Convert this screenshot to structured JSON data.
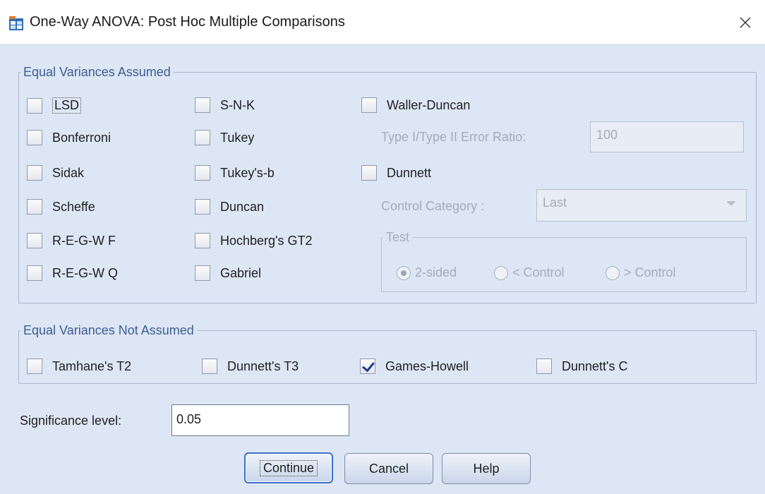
{
  "window": {
    "title": "One-Way ANOVA: Post Hoc Multiple Comparisons",
    "close_glyph": "×"
  },
  "equal_assumed": {
    "legend": "Equal Variances Assumed",
    "col1": [
      {
        "label": "LSD",
        "checked": false
      },
      {
        "label": "Bonferroni",
        "checked": false
      },
      {
        "label": "Sidak",
        "checked": false
      },
      {
        "label": "Scheffe",
        "checked": false
      },
      {
        "label": "R-E-G-W F",
        "checked": false
      },
      {
        "label": "R-E-G-W Q",
        "checked": false
      }
    ],
    "col2": [
      {
        "label": "S-N-K",
        "checked": false
      },
      {
        "label": "Tukey",
        "checked": false
      },
      {
        "label": "Tukey's-b",
        "checked": false
      },
      {
        "label": "Duncan",
        "checked": false
      },
      {
        "label": "Hochberg's GT2",
        "checked": false
      },
      {
        "label": "Gabriel",
        "checked": false
      }
    ],
    "waller_duncan": {
      "label": "Waller-Duncan",
      "checked": false
    },
    "error_ratio": {
      "label": "Type I/Type II Error Ratio:",
      "value": "100"
    },
    "dunnett": {
      "label": "Dunnett",
      "checked": false
    },
    "control_category": {
      "label": "Control Category :",
      "value": "Last"
    },
    "test": {
      "legend": "Test",
      "options": [
        {
          "label": "2-sided",
          "selected": true
        },
        {
          "label": "< Control",
          "selected": false
        },
        {
          "label": "> Control",
          "selected": false
        }
      ]
    }
  },
  "equal_not_assumed": {
    "legend": "Equal Variances Not Assumed",
    "items": [
      {
        "label": "Tamhane's T2",
        "checked": false
      },
      {
        "label": "Dunnett's T3",
        "checked": false
      },
      {
        "label": "Games-Howell",
        "checked": true
      },
      {
        "label": "Dunnett's C",
        "checked": false
      }
    ]
  },
  "significance": {
    "label": "Significance level:",
    "value": "0.05"
  },
  "buttons": {
    "continue": "Continue",
    "cancel": "Cancel",
    "help": "Help"
  },
  "colors": {
    "client_bg": "#dde6f4",
    "legend_text": "#3b5d93",
    "check_mark": "#1f3f86"
  }
}
